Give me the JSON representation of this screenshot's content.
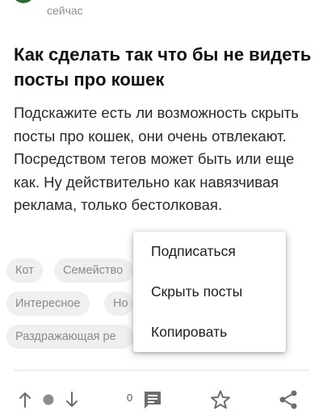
{
  "post": {
    "time": "сейчас",
    "title": "Как сделать так что бы не видеть посты про кошек",
    "body": "Подскажите есть ли возможность скрыть посты про кошек, они очень отвлекают. Посредством тегов может быть или еще как. Ну действительно как навязчивая реклама, только бестолковая.",
    "tags": [
      "Кот",
      "Семейство",
      "Интересное",
      "Но",
      "Раздражающая ре"
    ],
    "comments_count": "0"
  },
  "menu": {
    "items": [
      "Подписаться",
      "Скрыть посты",
      "Копировать"
    ]
  },
  "icons": {
    "upvote": "arrow-up-icon",
    "rating": "dot-icon",
    "downvote": "arrow-down-icon",
    "comments": "comment-icon",
    "save": "star-icon",
    "share": "share-icon"
  }
}
